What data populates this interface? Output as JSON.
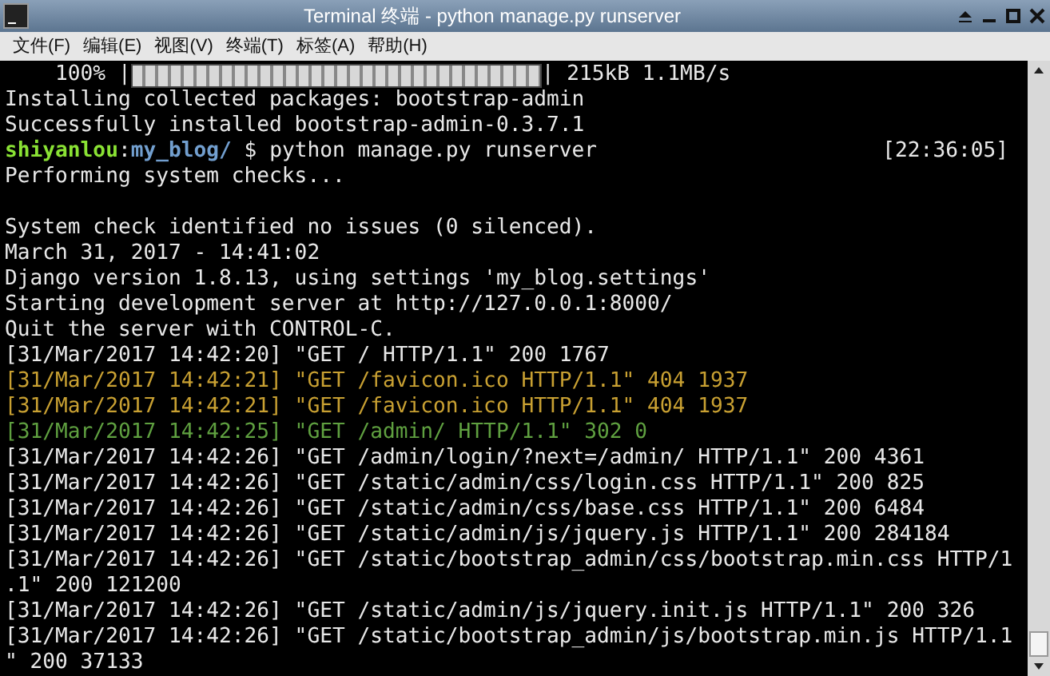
{
  "window": {
    "title": "Terminal 终端 - python manage.py runserver"
  },
  "menu": [
    {
      "label": "文件(F)"
    },
    {
      "label": "编辑(E)"
    },
    {
      "label": "视图(V)"
    },
    {
      "label": "终端(T)"
    },
    {
      "label": "标签(A)"
    },
    {
      "label": "帮助(H)"
    }
  ],
  "terminal": {
    "lines": [
      {
        "kind": "progress",
        "prefix": "    100% |",
        "level": 1,
        "suffix": "| 215kB 1.1MB/s"
      },
      {
        "kind": "plain",
        "text": "Installing collected packages: bootstrap-admin"
      },
      {
        "kind": "plain",
        "text": "Successfully installed bootstrap-admin-0.3.7.1"
      },
      {
        "kind": "prompt",
        "user": "shiyanlou",
        "separator": ":",
        "path": "my_blog/",
        "command": " $ python manage.py runserver",
        "time": "[22:36:05]"
      },
      {
        "kind": "plain",
        "text": "Performing system checks..."
      },
      {
        "kind": "blank"
      },
      {
        "kind": "plain",
        "text": "System check identified no issues (0 silenced)."
      },
      {
        "kind": "plain",
        "text": "March 31, 2017 - 14:41:02"
      },
      {
        "kind": "plain",
        "text": "Django version 1.8.13, using settings 'my_blog.settings'"
      },
      {
        "kind": "plain",
        "text": "Starting development server at http://127.0.0.1:8000/"
      },
      {
        "kind": "plain",
        "text": "Quit the server with CONTROL-C."
      },
      {
        "kind": "plain",
        "text": "[31/Mar/2017 14:42:20] \"GET / HTTP/1.1\" 200 1767"
      },
      {
        "kind": "warning",
        "text": "[31/Mar/2017 14:42:21] \"GET /favicon.ico HTTP/1.1\" 404 1937"
      },
      {
        "kind": "warning",
        "text": "[31/Mar/2017 14:42:21] \"GET /favicon.ico HTTP/1.1\" 404 1937"
      },
      {
        "kind": "redirect",
        "text": "[31/Mar/2017 14:42:25] \"GET /admin/ HTTP/1.1\" 302 0"
      },
      {
        "kind": "plain",
        "text": "[31/Mar/2017 14:42:26] \"GET /admin/login/?next=/admin/ HTTP/1.1\" 200 4361"
      },
      {
        "kind": "plain",
        "text": "[31/Mar/2017 14:42:26] \"GET /static/admin/css/login.css HTTP/1.1\" 200 825"
      },
      {
        "kind": "plain",
        "text": "[31/Mar/2017 14:42:26] \"GET /static/admin/css/base.css HTTP/1.1\" 200 6484"
      },
      {
        "kind": "plain",
        "text": "[31/Mar/2017 14:42:26] \"GET /static/admin/js/jquery.js HTTP/1.1\" 200 284184"
      },
      {
        "kind": "plain",
        "text": "[31/Mar/2017 14:42:26] \"GET /static/bootstrap_admin/css/bootstrap.min.css HTTP/1"
      },
      {
        "kind": "plain",
        "text": ".1\" 200 121200"
      },
      {
        "kind": "plain",
        "text": "[31/Mar/2017 14:42:26] \"GET /static/admin/js/jquery.init.js HTTP/1.1\" 200 326"
      },
      {
        "kind": "plain",
        "text": "[31/Mar/2017 14:42:26] \"GET /static/bootstrap_admin/js/bootstrap.min.js HTTP/1.1"
      },
      {
        "kind": "plain",
        "text": "\" 200 37133"
      }
    ]
  }
}
